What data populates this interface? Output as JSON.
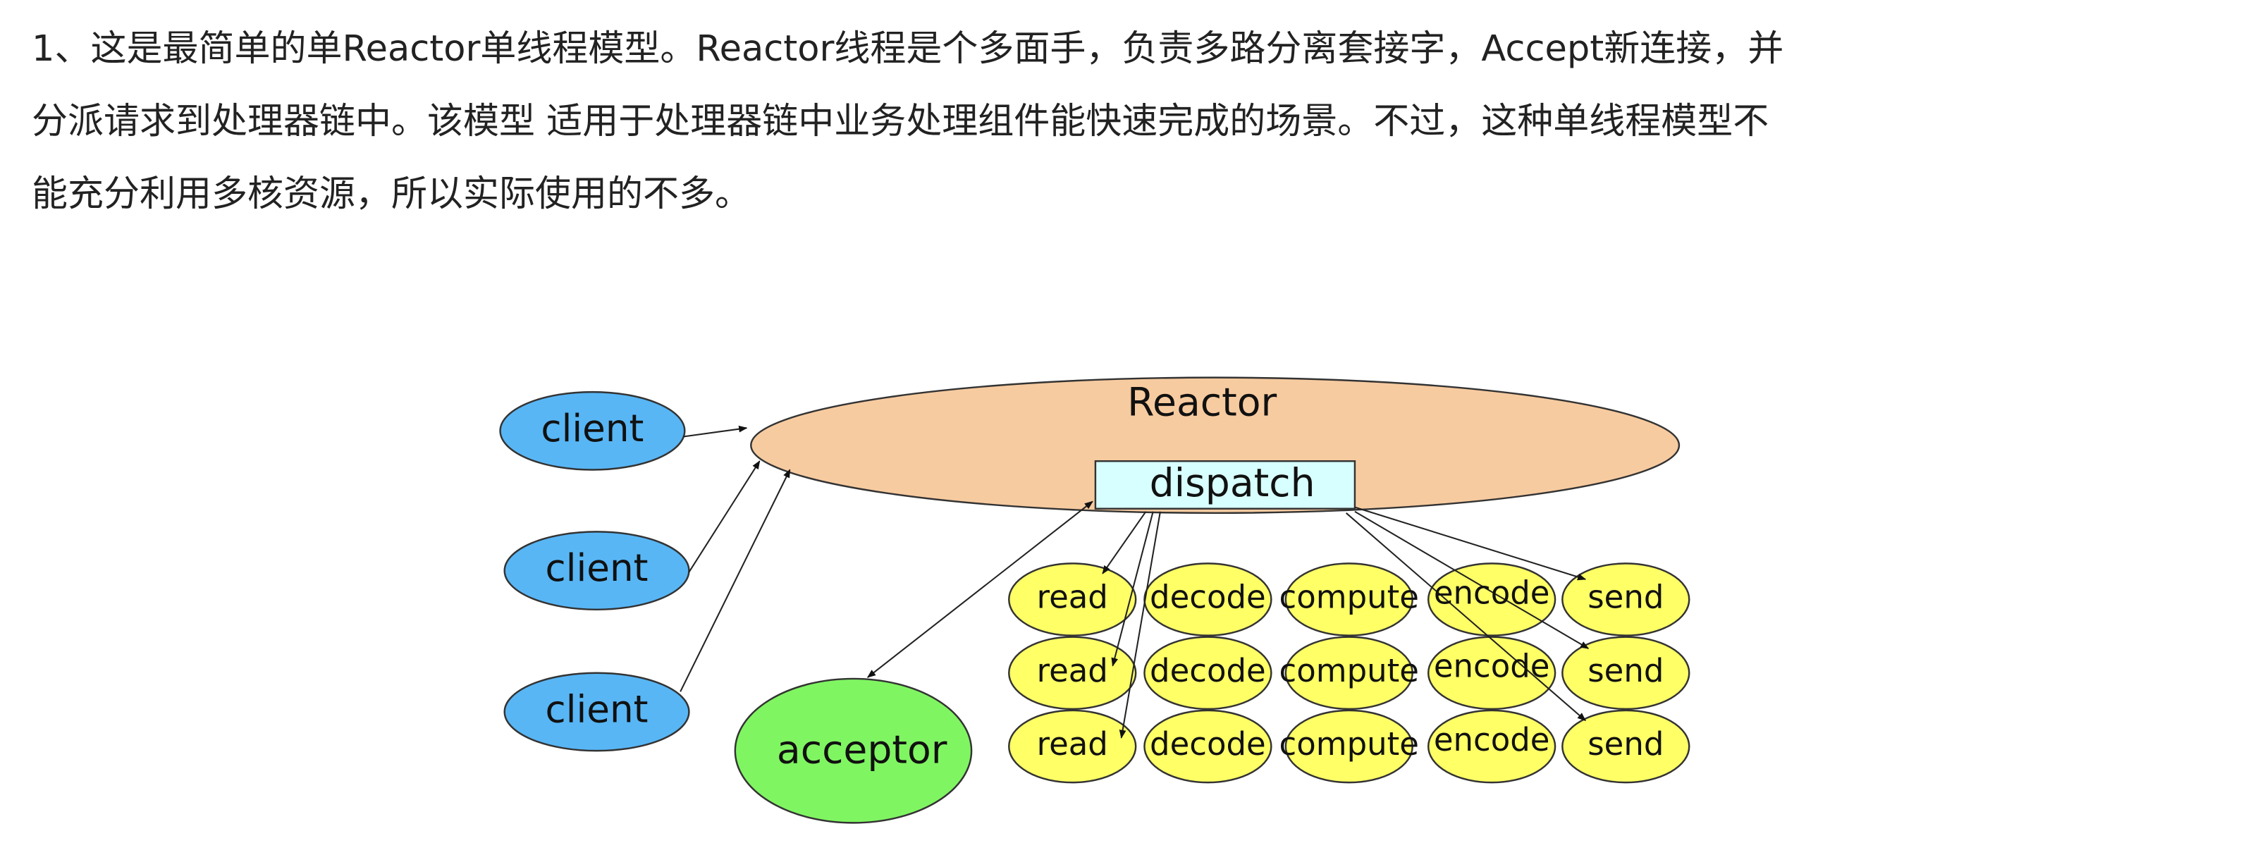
{
  "paragraph": {
    "lines": [
      "1、这是最简单的单Reactor单线程模型。Reactor线程是个多面手，负责多路分离套接字，Accept新连接，并",
      "分派请求到处理器链中。该模型 适用于处理器链中业务处理组件能快速完成的场景。不过，这种单线程模型不",
      "能充分利用多核资源，所以实际使用的不多。"
    ]
  },
  "diagram": {
    "reactor": "Reactor",
    "dispatch": "dispatch",
    "acceptor": "acceptor",
    "clients": [
      "client",
      "client",
      "client"
    ],
    "handler_rows": [
      [
        "read",
        "decode",
        "compute",
        "encode",
        "send"
      ],
      [
        "read",
        "decode",
        "compute",
        "encode",
        "send"
      ],
      [
        "read",
        "decode",
        "compute",
        "encode",
        "send"
      ]
    ],
    "colors": {
      "client": "#58b6f5",
      "reactor": "#f7cba0",
      "dispatch": "#d8ffff",
      "handler": "#ffff66",
      "acceptor": "#80f562"
    }
  }
}
